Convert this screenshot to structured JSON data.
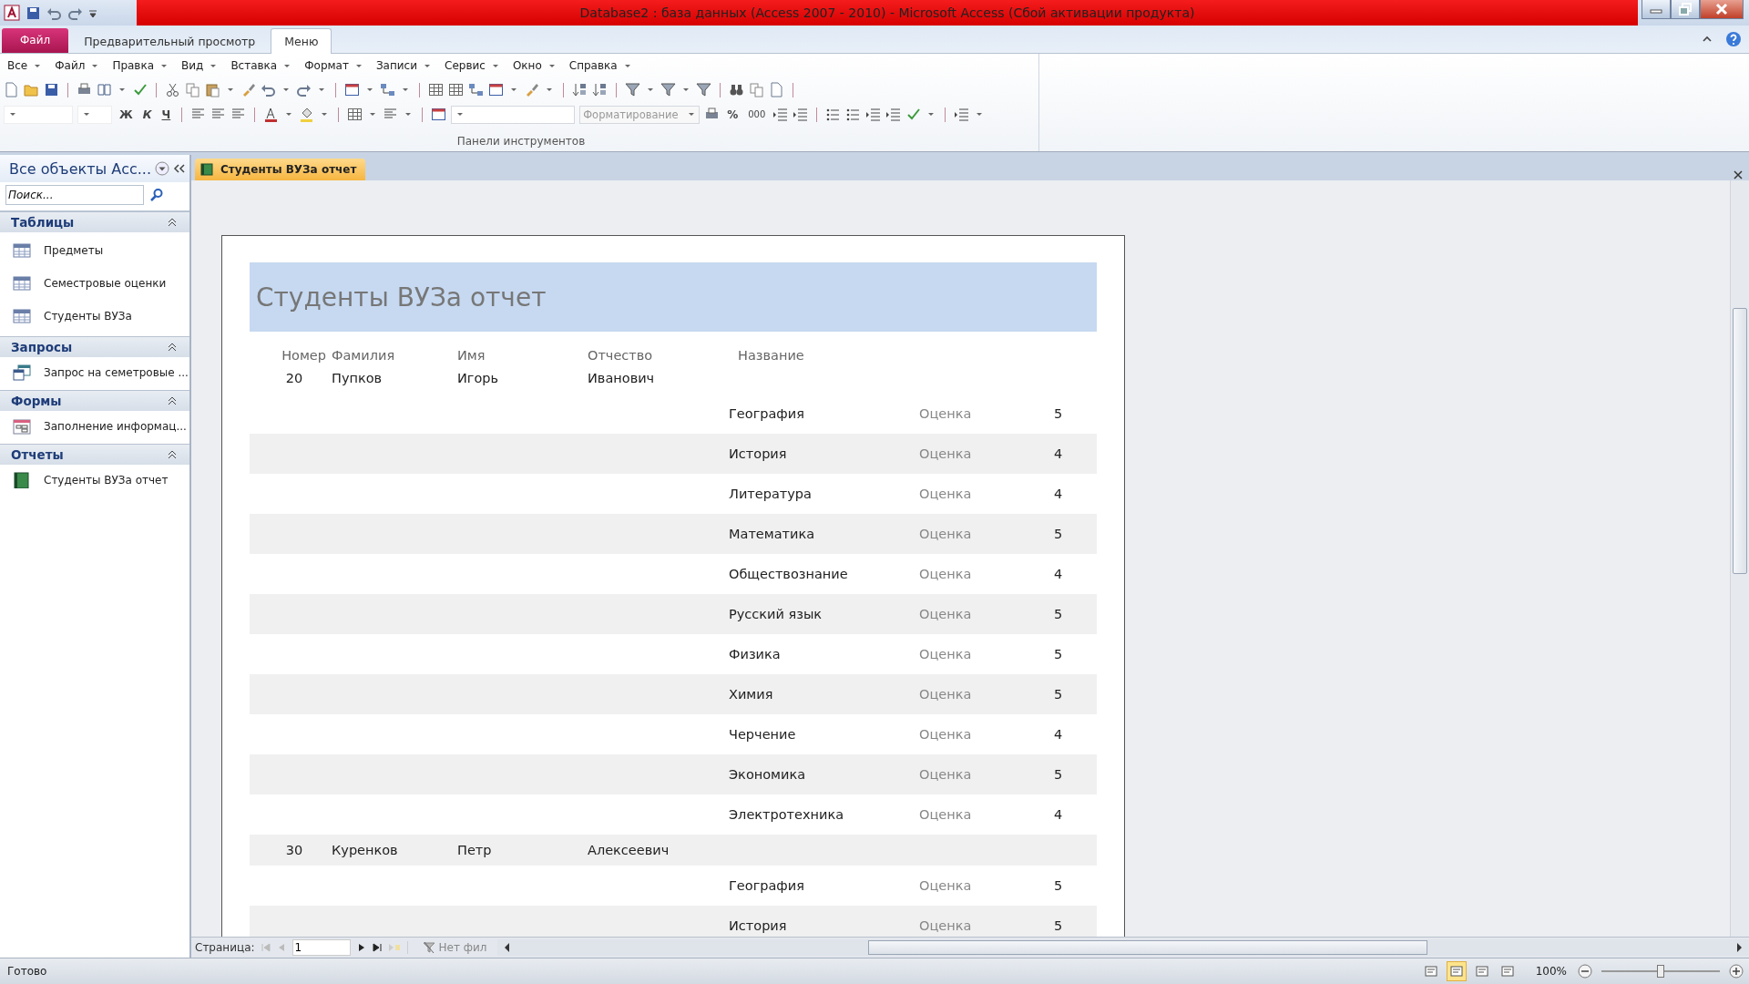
{
  "window": {
    "title": "Database2 : база данных (Access 2007 - 2010)  -  Microsoft Access (Сбой активации продукта)"
  },
  "ribbon_tabs": [
    {
      "label": "Файл",
      "kind": "file",
      "selected": false
    },
    {
      "label": "Предварительный просмотр",
      "kind": "tab",
      "selected": false
    },
    {
      "label": "Меню",
      "kind": "tab",
      "selected": true
    }
  ],
  "menu": [
    "Все",
    "Файл",
    "Правка",
    "Вид",
    "Вставка",
    "Формат",
    "Записи",
    "Сервис",
    "Окно",
    "Справка"
  ],
  "format_bar": {
    "bold": "Ж",
    "italic": "К",
    "underline": "Ч",
    "style_placeholder": "Форматирование",
    "percent": "%",
    "thousands": "000"
  },
  "ribbon_group": "Панели инструментов",
  "nav_pane": {
    "title": "Все объекты Асс...",
    "search": {
      "placeholder": "Поиск..."
    },
    "groups": [
      {
        "label": "Таблицы",
        "expanded": true,
        "items": [
          {
            "label": "Предметы",
            "kind": "table"
          },
          {
            "label": "Семестровые оценки",
            "kind": "table"
          },
          {
            "label": "Студенты ВУЗа",
            "kind": "table"
          }
        ]
      },
      {
        "label": "Запросы",
        "expanded": true,
        "items": [
          {
            "label": "Запрос на семетровые ...",
            "kind": "query"
          }
        ]
      },
      {
        "label": "Формы",
        "expanded": true,
        "items": [
          {
            "label": "Заполнение информац...",
            "kind": "form"
          }
        ]
      },
      {
        "label": "Отчеты",
        "expanded": true,
        "items": [
          {
            "label": "Студенты ВУЗа отчет",
            "kind": "report"
          }
        ]
      }
    ]
  },
  "document_tab": {
    "label": "Студенты ВУЗа отчет",
    "selected": true
  },
  "report": {
    "title": "Студенты ВУЗа отчет",
    "columns": [
      "Номер",
      "Фамилия",
      "Имя",
      "Отчество",
      "Название"
    ],
    "students": [
      {
        "number": "20",
        "last_name": "Пупков",
        "first_name": "Игорь",
        "patronymic": "Иванович",
        "grades": [
          {
            "subject": "География",
            "label": "Оценка",
            "grade": "5"
          },
          {
            "subject": "История",
            "label": "Оценка",
            "grade": "4"
          },
          {
            "subject": "Литература",
            "label": "Оценка",
            "grade": "4"
          },
          {
            "subject": "Математика",
            "label": "Оценка",
            "grade": "5"
          },
          {
            "subject": "Обществознание",
            "label": "Оценка",
            "grade": "4"
          },
          {
            "subject": "Русский язык",
            "label": "Оценка",
            "grade": "5"
          },
          {
            "subject": "Физика",
            "label": "Оценка",
            "grade": "5"
          },
          {
            "subject": "Химия",
            "label": "Оценка",
            "grade": "5"
          },
          {
            "subject": "Черчение",
            "label": "Оценка",
            "grade": "4"
          },
          {
            "subject": "Экономика",
            "label": "Оценка",
            "grade": "5"
          },
          {
            "subject": "Электротехника",
            "label": "Оценка",
            "grade": "4"
          }
        ]
      },
      {
        "number": "30",
        "last_name": "Куренков",
        "first_name": "Петр",
        "patronymic": "Алексеевич",
        "grades": [
          {
            "subject": "География",
            "label": "Оценка",
            "grade": "5"
          },
          {
            "subject": "История",
            "label": "Оценка",
            "grade": "5"
          }
        ]
      }
    ]
  },
  "page_nav": {
    "label": "Страница:",
    "value": "1",
    "filter": "Нет фил"
  },
  "status_bar": {
    "text": "Готово",
    "views": [
      {
        "selected": false
      },
      {
        "selected": true
      },
      {
        "selected": false
      },
      {
        "selected": false
      }
    ],
    "zoom": "100%",
    "zoom_slider": {
      "level": 0.5
    }
  }
}
